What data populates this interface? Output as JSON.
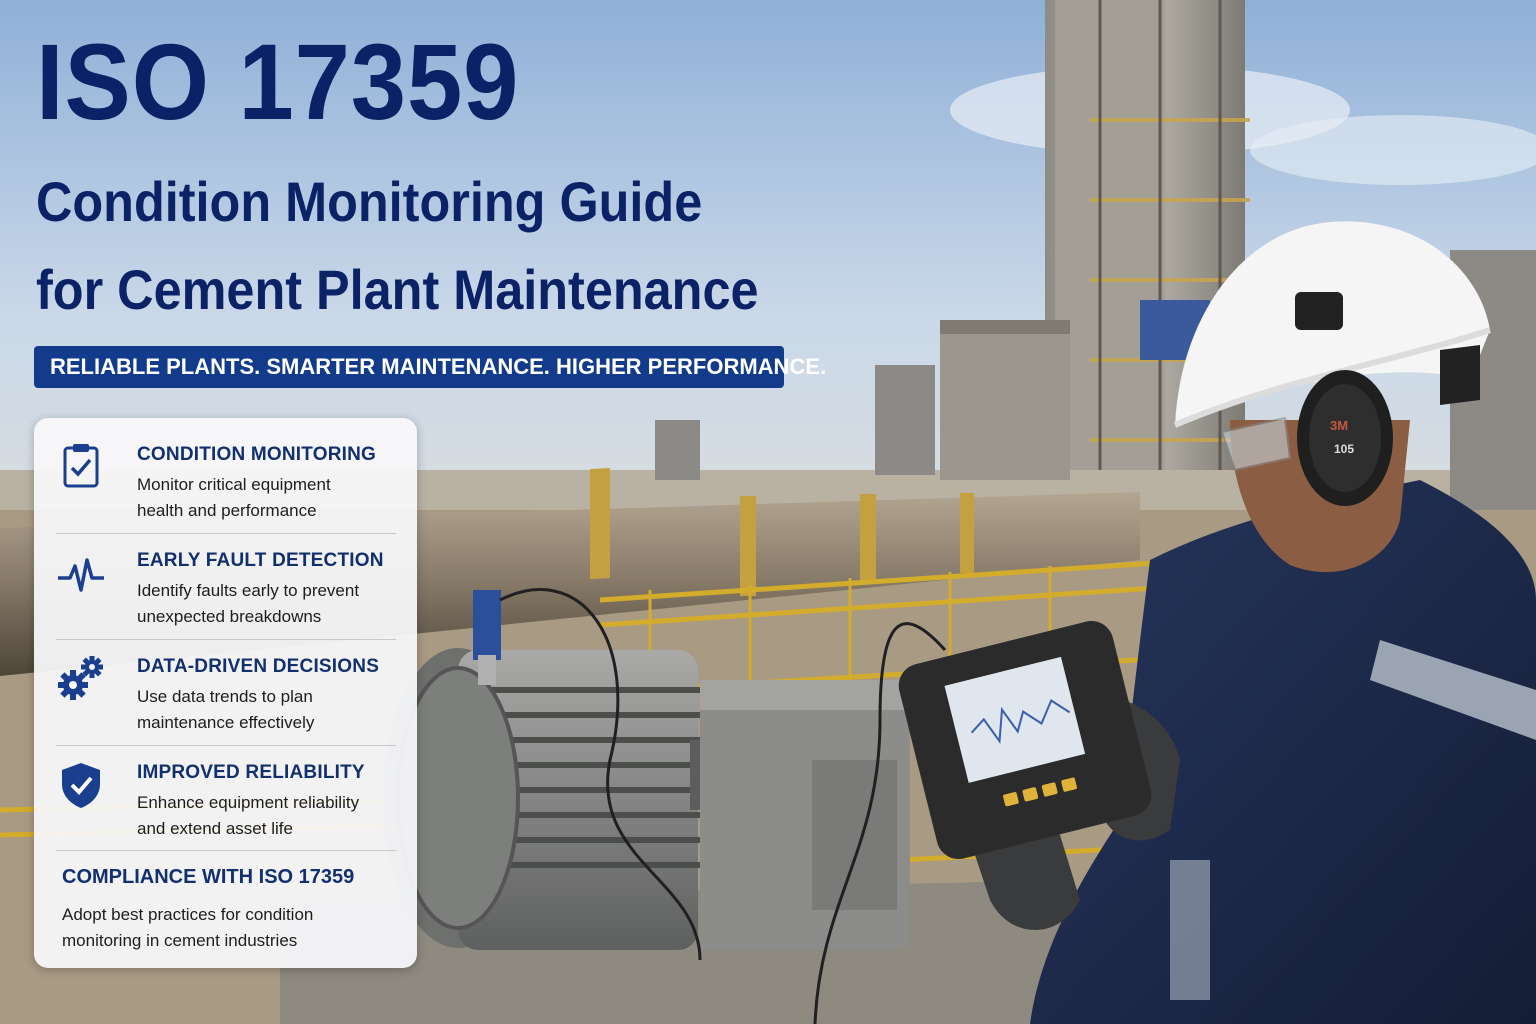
{
  "headline": {
    "main": "ISO 17359",
    "line2": "Condition Monitoring Guide",
    "line3": "for Cement Plant Maintenance"
  },
  "tagline": "RELIABLE PLANTS. SMARTER MAINTENANCE. HIGHER PERFORMANCE.",
  "features": [
    {
      "icon": "clipboard-check-icon",
      "title": "CONDITION MONITORING",
      "desc_line1": "Monitor critical equipment",
      "desc_line2": "health and performance"
    },
    {
      "icon": "heartbeat-pulse-icon",
      "title": "EARLY FAULT DETECTION",
      "desc_line1": "Identify faults early to prevent",
      "desc_line2": "unexpected breakdowns"
    },
    {
      "icon": "gears-icon",
      "title": "DATA-DRIVEN DECISIONS",
      "desc_line1": "Use data trends to plan",
      "desc_line2": "maintenance effectively"
    },
    {
      "icon": "shield-check-icon",
      "title": "IMPROVED RELIABILITY",
      "desc_line1": "Enhance equipment reliability",
      "desc_line2": "and extend asset life"
    }
  ],
  "compliance": {
    "title": "COMPLIANCE WITH ISO 17359",
    "desc_line1": "Adopt best practices for condition",
    "desc_line2": "monitoring in cement industries"
  },
  "scene": {
    "earmuff_brand": "3M",
    "earmuff_rating": "105"
  },
  "colors": {
    "headline": "#0b2366",
    "tagline_bg": "#123b8c",
    "icon_blue": "#1a3f8f",
    "card_bg": "#f8f8fa"
  }
}
